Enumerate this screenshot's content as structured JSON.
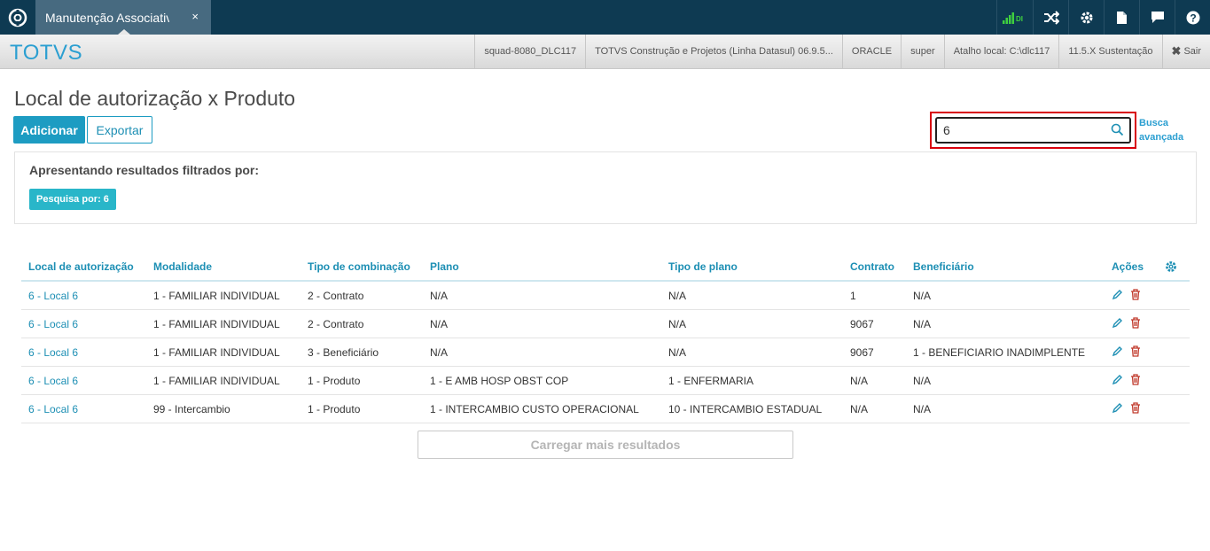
{
  "topbar": {
    "tab_title": "Manutenção Associativa",
    "tab_close": "×",
    "signal_label": "DI",
    "colors": {
      "bar": "#0e3a52",
      "tab": "#476a80",
      "signal": "#3fcf3f"
    }
  },
  "subbar": {
    "brand": "TOTVS",
    "infos": [
      "squad-8080_DLC117",
      "TOTVS Construção e Projetos (Linha Datasul) 06.9.5...",
      "ORACLE",
      "super",
      "Atalho local: C:\\dlc117",
      "11.5.X Sustentação"
    ],
    "logout": "Sair"
  },
  "page": {
    "title": "Local de autorização x Produto",
    "add_label": "Adicionar",
    "export_label": "Exportar",
    "search_value": "6",
    "advanced_search_line1": "Busca",
    "advanced_search_line2": "avançada",
    "filter_title": "Apresentando resultados filtrados por:",
    "filter_chip": "Pesquisa por: 6",
    "load_more": "Carregar mais resultados"
  },
  "table": {
    "headers": [
      "Local de autorização",
      "Modalidade",
      "Tipo de combinação",
      "Plano",
      "Tipo de plano",
      "Contrato",
      "Beneficiário",
      "Ações"
    ],
    "rows": [
      [
        "6 - Local 6",
        "1 - FAMILIAR INDIVIDUAL",
        "2 - Contrato",
        "N/A",
        "N/A",
        "1",
        "N/A"
      ],
      [
        "6 - Local 6",
        "1 - FAMILIAR INDIVIDUAL",
        "2 - Contrato",
        "N/A",
        "N/A",
        "9067",
        "N/A"
      ],
      [
        "6 - Local 6",
        "1 - FAMILIAR INDIVIDUAL",
        "3 - Beneficiário",
        "N/A",
        "N/A",
        "9067",
        "1 - BENEFICIARIO INADIMPLENTE"
      ],
      [
        "6 - Local 6",
        "1 - FAMILIAR INDIVIDUAL",
        "1 - Produto",
        "1 - E AMB HOSP OBST COP",
        "1 - ENFERMARIA",
        "N/A",
        "N/A"
      ],
      [
        "6 - Local 6",
        "99 - Intercambio",
        "1 - Produto",
        "1 - INTERCAMBIO CUSTO OPERACIONAL",
        "10 - INTERCAMBIO ESTADUAL",
        "N/A",
        "N/A"
      ]
    ],
    "colors": {
      "link": "#1d8fb4",
      "edit": "#1d8fb4",
      "delete": "#c0392b"
    }
  }
}
